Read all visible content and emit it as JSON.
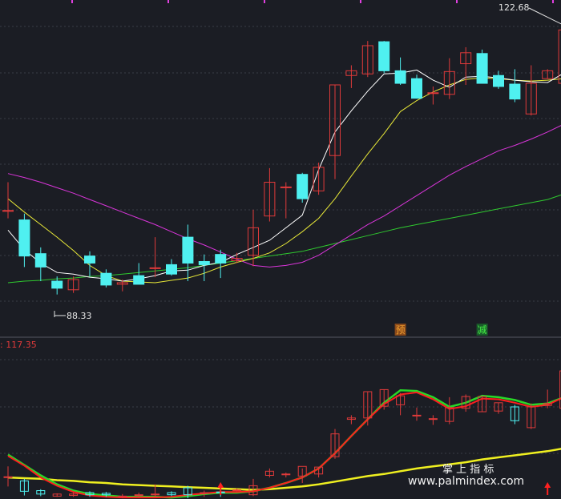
{
  "chart_data": {
    "type": "candlestick",
    "main": {
      "high_label": "122.68",
      "low_label": "88.33",
      "ylim": [
        85,
        125
      ],
      "grid": true,
      "colors": {
        "up": "#e03a3a",
        "down": "#4ff0f0",
        "ma5": "#ffffff",
        "ma10": "#e8e838",
        "ma20": "#d935d9",
        "ma60": "#2fc82f"
      },
      "candles": [
        {
          "o": 99.0,
          "h": 102.6,
          "l": 98.0,
          "c": 99.0
        },
        {
          "o": 97.8,
          "h": 98.6,
          "l": 91.8,
          "c": 93.2
        },
        {
          "o": 93.5,
          "h": 94.3,
          "l": 90.0,
          "c": 91.8
        },
        {
          "o": 90.0,
          "h": 90.6,
          "l": 88.3,
          "c": 89.1
        },
        {
          "o": 88.9,
          "h": 90.6,
          "l": 88.5,
          "c": 90.2
        },
        {
          "o": 93.2,
          "h": 93.8,
          "l": 90.6,
          "c": 92.3
        },
        {
          "o": 91.0,
          "h": 91.5,
          "l": 89.2,
          "c": 89.5
        },
        {
          "o": 89.6,
          "h": 90.2,
          "l": 88.7,
          "c": 89.8
        },
        {
          "o": 90.7,
          "h": 92.3,
          "l": 89.7,
          "c": 89.6
        },
        {
          "o": 91.7,
          "h": 95.6,
          "l": 90.5,
          "c": 91.7
        },
        {
          "o": 92.1,
          "h": 92.8,
          "l": 90.7,
          "c": 90.9
        },
        {
          "o": 95.6,
          "h": 97.2,
          "l": 90.0,
          "c": 92.3
        },
        {
          "o": 92.5,
          "h": 93.4,
          "l": 90.0,
          "c": 92.1
        },
        {
          "o": 93.4,
          "h": 94.0,
          "l": 90.4,
          "c": 92.3
        },
        {
          "o": 92.6,
          "h": 93.6,
          "l": 92.3,
          "c": 92.9
        },
        {
          "o": 93.3,
          "h": 99.1,
          "l": 91.9,
          "c": 96.8
        },
        {
          "o": 98.3,
          "h": 104.4,
          "l": 97.6,
          "c": 102.6
        },
        {
          "o": 102.0,
          "h": 102.6,
          "l": 98.0,
          "c": 102.0
        },
        {
          "o": 103.6,
          "h": 103.8,
          "l": 100.0,
          "c": 100.5
        },
        {
          "o": 101.5,
          "h": 105.1,
          "l": 101.0,
          "c": 104.5
        },
        {
          "o": 106.0,
          "h": 115.0,
          "l": 103.0,
          "c": 115.0
        },
        {
          "o": 116.2,
          "h": 117.5,
          "l": 114.6,
          "c": 116.8
        },
        {
          "o": 116.4,
          "h": 120.6,
          "l": 116.0,
          "c": 120.0
        },
        {
          "o": 120.5,
          "h": 120.6,
          "l": 116.5,
          "c": 116.8
        },
        {
          "o": 116.8,
          "h": 118.5,
          "l": 115.0,
          "c": 115.2
        },
        {
          "o": 115.8,
          "h": 116.3,
          "l": 113.3,
          "c": 113.3
        },
        {
          "o": 114.0,
          "h": 114.8,
          "l": 112.5,
          "c": 114.0
        },
        {
          "o": 113.8,
          "h": 118.4,
          "l": 113.2,
          "c": 116.7
        },
        {
          "o": 117.7,
          "h": 119.8,
          "l": 115.0,
          "c": 119.1
        },
        {
          "o": 119.0,
          "h": 119.5,
          "l": 115.2,
          "c": 115.2
        },
        {
          "o": 116.2,
          "h": 116.8,
          "l": 114.5,
          "c": 114.8
        },
        {
          "o": 115.1,
          "h": 117.0,
          "l": 112.8,
          "c": 113.2
        },
        {
          "o": 111.3,
          "h": 117.5,
          "l": 111.1,
          "c": 115.2
        },
        {
          "o": 115.8,
          "h": 117.0,
          "l": 115.8,
          "c": 116.8
        },
        {
          "o": 115.2,
          "h": 122.7,
          "l": 115.0,
          "c": 122.0
        }
      ],
      "ma5": [
        96.5,
        94.0,
        92.3,
        91.1,
        90.9,
        90.5,
        90.3,
        90.0,
        90.3,
        90.7,
        91.3,
        91.4,
        92.0,
        92.4,
        93.4,
        94.3,
        95.2,
        96.8,
        98.4,
        104.2,
        109.0,
        111.7,
        114.2,
        116.4,
        116.5,
        116.9,
        115.6,
        114.7,
        116.0,
        116.1,
        115.9,
        115.6,
        115.4,
        115.3,
        116.5
      ],
      "ma10": [
        100.5,
        98.8,
        97.2,
        95.6,
        93.9,
        92.0,
        90.7,
        90.0,
        89.9,
        89.8,
        90.1,
        90.4,
        91.0,
        91.8,
        92.4,
        92.9,
        93.6,
        94.8,
        96.3,
        98.0,
        100.5,
        103.4,
        106.2,
        108.8,
        111.6,
        113.0,
        114.1,
        115.0,
        115.7,
        115.9,
        115.8,
        115.6,
        115.5,
        115.6,
        115.8
      ],
      "ma20": [
        103.7,
        103.2,
        102.6,
        101.9,
        101.2,
        100.4,
        99.6,
        98.8,
        98.0,
        97.2,
        96.3,
        95.4,
        94.6,
        93.7,
        92.8,
        92.0,
        91.8,
        92.0,
        92.4,
        93.3,
        94.6,
        95.9,
        97.2,
        98.3,
        99.6,
        100.9,
        102.2,
        103.5,
        104.6,
        105.6,
        106.6,
        107.3,
        108.1,
        109.0,
        110.0
      ],
      "ma60": [
        89.8,
        90.0,
        90.1,
        90.3,
        90.4,
        90.6,
        90.7,
        90.9,
        91.1,
        91.3,
        91.5,
        91.7,
        92.0,
        92.3,
        92.6,
        92.9,
        93.2,
        93.5,
        93.8,
        94.3,
        94.8,
        95.3,
        95.8,
        96.3,
        96.8,
        97.2,
        97.6,
        98.0,
        98.4,
        98.8,
        99.2,
        99.6,
        100.0,
        100.4,
        101.1
      ]
    },
    "markers": [
      {
        "index": 24,
        "text": "预",
        "bg": "#8a4a1a",
        "color": "#f0a030"
      },
      {
        "index": 29,
        "text": "减",
        "bg": "#1a5a2a",
        "color": "#44f044"
      }
    ],
    "sub": {
      "label": ": 117.35",
      "ylim": [
        100,
        122
      ],
      "candles": [
        {
          "o": 103.1,
          "h": 104.6,
          "l": 101.7,
          "c": 103.1
        },
        {
          "o": 102.5,
          "h": 102.8,
          "l": 100.4,
          "c": 101.0
        },
        {
          "o": 101.1,
          "h": 101.3,
          "l": 100.3,
          "c": 100.6
        },
        {
          "o": 100.3,
          "h": 100.7,
          "l": 100.2,
          "c": 100.6
        },
        {
          "o": 100.4,
          "h": 100.9,
          "l": 100.2,
          "c": 100.6
        },
        {
          "o": 100.8,
          "h": 101.0,
          "l": 100.2,
          "c": 100.5
        },
        {
          "o": 100.7,
          "h": 100.9,
          "l": 100.2,
          "c": 100.5
        },
        {
          "o": 100.3,
          "h": 100.6,
          "l": 100.0,
          "c": 100.3
        },
        {
          "o": 100.4,
          "h": 100.8,
          "l": 100.0,
          "c": 100.5
        },
        {
          "o": 100.5,
          "h": 102.0,
          "l": 100.2,
          "c": 100.6
        },
        {
          "o": 100.8,
          "h": 101.0,
          "l": 100.3,
          "c": 100.5
        },
        {
          "o": 101.5,
          "h": 101.8,
          "l": 100.0,
          "c": 100.5
        },
        {
          "o": 100.8,
          "h": 101.1,
          "l": 100.2,
          "c": 100.8
        },
        {
          "o": 100.9,
          "h": 101.0,
          "l": 100.2,
          "c": 100.8
        },
        {
          "o": 101.2,
          "h": 101.4,
          "l": 101.0,
          "c": 101.2
        },
        {
          "o": 100.5,
          "h": 102.8,
          "l": 100.3,
          "c": 101.8
        },
        {
          "o": 103.3,
          "h": 104.3,
          "l": 103.0,
          "c": 103.9
        },
        {
          "o": 103.5,
          "h": 103.7,
          "l": 103.0,
          "c": 103.5
        },
        {
          "o": 103.2,
          "h": 104.3,
          "l": 102.2,
          "c": 104.6
        },
        {
          "o": 103.5,
          "h": 104.5,
          "l": 103.0,
          "c": 104.5
        },
        {
          "o": 106.0,
          "h": 110.0,
          "l": 105.7,
          "c": 109.3
        },
        {
          "o": 111.4,
          "h": 112.0,
          "l": 110.7,
          "c": 111.6
        },
        {
          "o": 111.6,
          "h": 115.4,
          "l": 110.5,
          "c": 115.4
        },
        {
          "o": 113.3,
          "h": 115.7,
          "l": 112.8,
          "c": 115.7
        },
        {
          "o": 113.5,
          "h": 115.2,
          "l": 112.0,
          "c": 114.8
        },
        {
          "o": 112.0,
          "h": 113.1,
          "l": 111.2,
          "c": 112.0
        },
        {
          "o": 111.5,
          "h": 112.0,
          "l": 110.6,
          "c": 111.5
        },
        {
          "o": 111.1,
          "h": 114.6,
          "l": 110.7,
          "c": 113.1
        },
        {
          "o": 113.0,
          "h": 115.0,
          "l": 112.5,
          "c": 114.7
        },
        {
          "o": 112.5,
          "h": 114.7,
          "l": 112.5,
          "c": 114.7
        },
        {
          "o": 112.6,
          "h": 113.8,
          "l": 112.2,
          "c": 113.8
        },
        {
          "o": 113.2,
          "h": 113.5,
          "l": 110.7,
          "c": 111.2
        },
        {
          "o": 110.2,
          "h": 113.7,
          "l": 110.0,
          "c": 113.2
        },
        {
          "o": 113.4,
          "h": 115.7,
          "l": 113.0,
          "c": 113.7
        },
        {
          "o": 113.0,
          "h": 119.0,
          "l": 112.8,
          "c": 118.4
        }
      ],
      "red_line": [
        106.1,
        104.7,
        103.0,
        101.8,
        100.9,
        100.4,
        100.2,
        100.1,
        100.1,
        100.1,
        100.2,
        100.5,
        100.7,
        100.9,
        100.9,
        101.0,
        101.5,
        102.2,
        103.0,
        104.3,
        106.5,
        109.0,
        111.4,
        113.6,
        115.0,
        115.3,
        114.3,
        112.9,
        113.3,
        114.4,
        114.3,
        113.8,
        113.2,
        113.5,
        114.6
      ],
      "green_line": [
        106.3,
        104.8,
        103.3,
        102.0,
        101.1,
        100.6,
        100.4,
        100.2,
        100.2,
        100.2,
        100.1,
        100.3,
        100.6,
        100.8,
        100.8,
        101.0,
        101.5,
        102.2,
        103.0,
        104.3,
        106.5,
        109.0,
        111.4,
        113.8,
        115.6,
        115.5,
        114.6,
        113.2,
        113.8,
        114.8,
        114.6,
        114.2,
        113.5,
        113.7,
        114.6
      ],
      "yellow_line": [
        103.0,
        102.9,
        102.8,
        102.6,
        102.5,
        102.3,
        102.2,
        102.0,
        101.9,
        101.8,
        101.7,
        101.6,
        101.5,
        101.4,
        101.3,
        101.2,
        101.3,
        101.5,
        101.7,
        102.0,
        102.4,
        102.8,
        103.2,
        103.5,
        103.9,
        104.3,
        104.6,
        104.9,
        105.2,
        105.6,
        105.9,
        106.2,
        106.5,
        106.8,
        107.2
      ],
      "arrow_indices": [
        13,
        33
      ]
    },
    "watermark": {
      "line1": "掌  上  指  标",
      "line2": "www.palmindex.com"
    }
  }
}
